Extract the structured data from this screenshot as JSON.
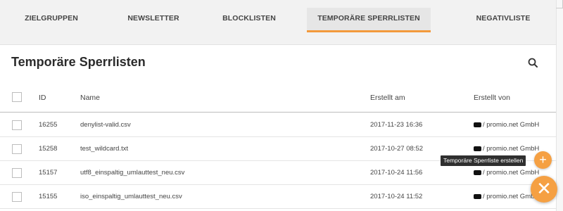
{
  "tabs": [
    {
      "label": "ZIELGRUPPEN"
    },
    {
      "label": "NEWSLETTER"
    },
    {
      "label": "BLOCKLISTEN"
    },
    {
      "label": "TEMPORÄRE SPERRLISTEN"
    },
    {
      "label": "NEGATIVLISTE"
    }
  ],
  "active_tab": "TEMPORÄRE SPERRLISTEN",
  "card": {
    "title": "Temporäre Sperrlisten",
    "search_icon": "search-icon"
  },
  "table": {
    "headers": {
      "id": "ID",
      "name": "Name",
      "created_at": "Erstellt am",
      "created_by": "Erstellt von"
    },
    "rows": [
      {
        "id": "16255",
        "name": "denylist-valid.csv",
        "created_at": "2017-11-23 16:36",
        "created_by": "/ promio.net GmbH"
      },
      {
        "id": "15258",
        "name": "test_wildcard.txt",
        "created_at": "2017-10-27 08:52",
        "created_by": "/ promio.net GmbH"
      },
      {
        "id": "15157",
        "name": "utf8_einspaltig_umlauttest_neu.csv",
        "created_at": "2017-10-24 11:56",
        "created_by": "/ promio.net GmbH"
      },
      {
        "id": "15155",
        "name": "iso_einspaltig_umlauttest_neu.csv",
        "created_at": "2017-10-24 11:52",
        "created_by": "/ promio.net GmbH"
      }
    ]
  },
  "tooltip": "Temporäre Sperrliste erstellen",
  "fab_add_icon": "plus-icon",
  "fab_close_icon": "close-icon",
  "colors": {
    "accent": "#f39a3c",
    "fab": "#f5a043"
  }
}
